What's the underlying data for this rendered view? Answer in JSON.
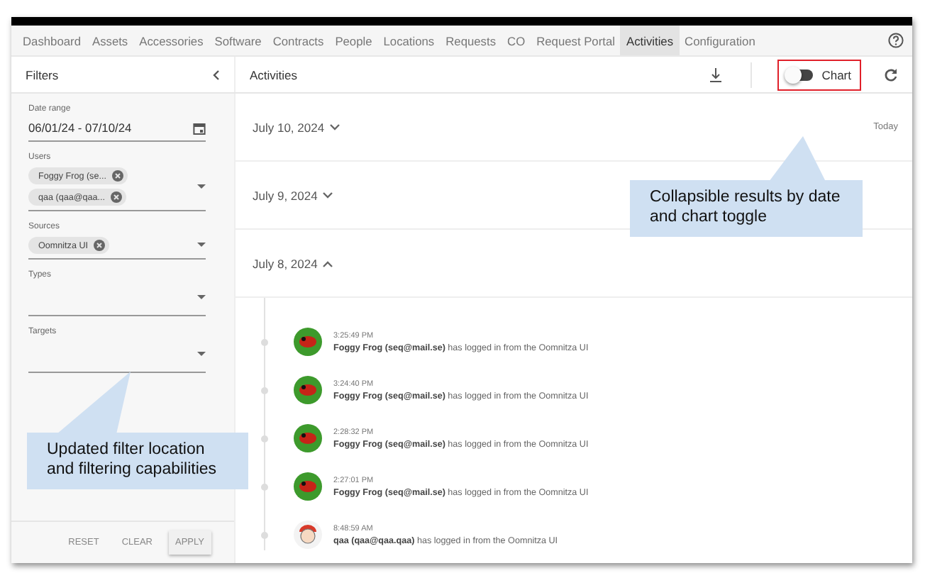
{
  "nav": {
    "items": [
      {
        "label": "Dashboard",
        "selected": false
      },
      {
        "label": "Assets",
        "selected": false
      },
      {
        "label": "Accessories",
        "selected": false
      },
      {
        "label": "Software",
        "selected": false
      },
      {
        "label": "Contracts",
        "selected": false
      },
      {
        "label": "People",
        "selected": false
      },
      {
        "label": "Locations",
        "selected": false
      },
      {
        "label": "Requests",
        "selected": false
      },
      {
        "label": "CO",
        "selected": false
      },
      {
        "label": "Request Portal",
        "selected": false
      },
      {
        "label": "Activities",
        "selected": true
      },
      {
        "label": "Configuration",
        "selected": false
      }
    ]
  },
  "filters": {
    "title": "Filters",
    "fields": [
      {
        "kind": "date",
        "label": "Date range",
        "value": "06/01/24 - 07/10/24"
      },
      {
        "kind": "select",
        "label": "Users",
        "chips": [
          "Foggy Frog (se...",
          "qaa (qaa@qaa..."
        ]
      },
      {
        "kind": "select",
        "label": "Sources",
        "chips": [
          "Oomnitza UI"
        ]
      },
      {
        "kind": "select",
        "label": "Types"
      },
      {
        "kind": "select",
        "label": "Targets"
      }
    ],
    "buttons": [
      {
        "label": "RESET",
        "kind": "text"
      },
      {
        "label": "CLEAR",
        "kind": "text"
      },
      {
        "label": "APPLY",
        "kind": "raised"
      }
    ]
  },
  "main": {
    "title": "Activities",
    "chart_toggle": {
      "label": "Chart",
      "on": false
    },
    "days": [
      {
        "date": "July 10, 2024",
        "expanded": false,
        "note": "Today"
      },
      {
        "date": "July 9, 2024",
        "expanded": false
      },
      {
        "date": "July 8, 2024",
        "expanded": true,
        "entries": [
          {
            "kind": "frog",
            "time": "3:25:49 PM",
            "text": "**Foggy Frog (seq@mail.se)** has logged in from the Oomnitza UI"
          },
          {
            "kind": "frog",
            "time": "3:24:40 PM",
            "text": "**Foggy Frog (seq@mail.se)** has logged in from the Oomnitza UI"
          },
          {
            "kind": "frog",
            "time": "2:28:32 PM",
            "text": "**Foggy Frog (seq@mail.se)** has logged in from the Oomnitza UI"
          },
          {
            "kind": "frog",
            "time": "2:27:01 PM",
            "text": "**Foggy Frog (seq@mail.se)** has logged in from the Oomnitza UI"
          },
          {
            "kind": "person",
            "time": "8:48:59 AM",
            "text": "**qaa (qaa@qaa.qaa)** has logged in from the Oomnitza UI"
          }
        ]
      }
    ]
  },
  "callouts": [
    {
      "text": "Updated filter location and filtering capabilities",
      "kind": "filters"
    },
    {
      "text": "Collapsible results by date and chart toggle",
      "kind": "toggle"
    }
  ]
}
